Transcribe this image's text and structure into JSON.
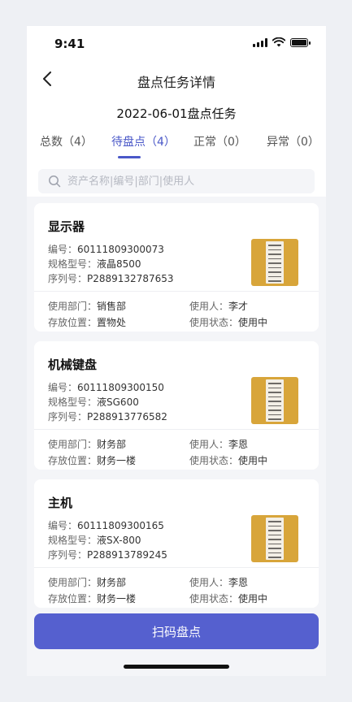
{
  "status_bar": {
    "time": "9:41"
  },
  "nav": {
    "title": "盘点任务详情"
  },
  "task": {
    "title": "2022-06-01盘点任务"
  },
  "tabs": [
    {
      "label": "总数（4）"
    },
    {
      "label": "待盘点（4）"
    },
    {
      "label": "正常（0）"
    },
    {
      "label": "异常（0）"
    }
  ],
  "active_tab": "待盘点（4）",
  "search": {
    "placeholder": "资产名称|编号|部门|使用人"
  },
  "assets": [
    {
      "name": "显示器",
      "code_label": "编号：",
      "code": "60111809300073",
      "model_label": "规格型号：",
      "model": "液晶8500",
      "serial_label": "序列号：",
      "serial": "P2889132787653",
      "dept_label": "使用部门：",
      "dept": "销售部",
      "user_label": "使用人：",
      "user": "李才",
      "location_label": "存放位置：",
      "location": "置物处",
      "state_label": "使用状态：",
      "state": "使用中"
    },
    {
      "name": "机械键盘",
      "code_label": "编号：",
      "code": "60111809300150",
      "model_label": "规格型号：",
      "model": "液SG600",
      "serial_label": "序列号：",
      "serial": "P288913776582",
      "dept_label": "使用部门：",
      "dept": "财务部",
      "user_label": "使用人：",
      "user": "李恩",
      "location_label": "存放位置：",
      "location": "财务一楼",
      "state_label": "使用状态：",
      "state": "使用中"
    },
    {
      "name": "主机",
      "code_label": "编号：",
      "code": "60111809300165",
      "model_label": "规格型号：",
      "model": "液SX-800",
      "serial_label": "序列号：",
      "serial": "P288913789245",
      "dept_label": "使用部门：",
      "dept": "财务部",
      "user_label": "使用人：",
      "user": "李恩",
      "location_label": "存放位置：",
      "location": "财务一楼",
      "state_label": "使用状态：",
      "state": "使用中"
    }
  ],
  "actions": {
    "scan_label": "扫码盘点"
  },
  "colors": {
    "accent": "#4a58c8",
    "button": "#5560cf",
    "background": "#f4f5f8"
  }
}
